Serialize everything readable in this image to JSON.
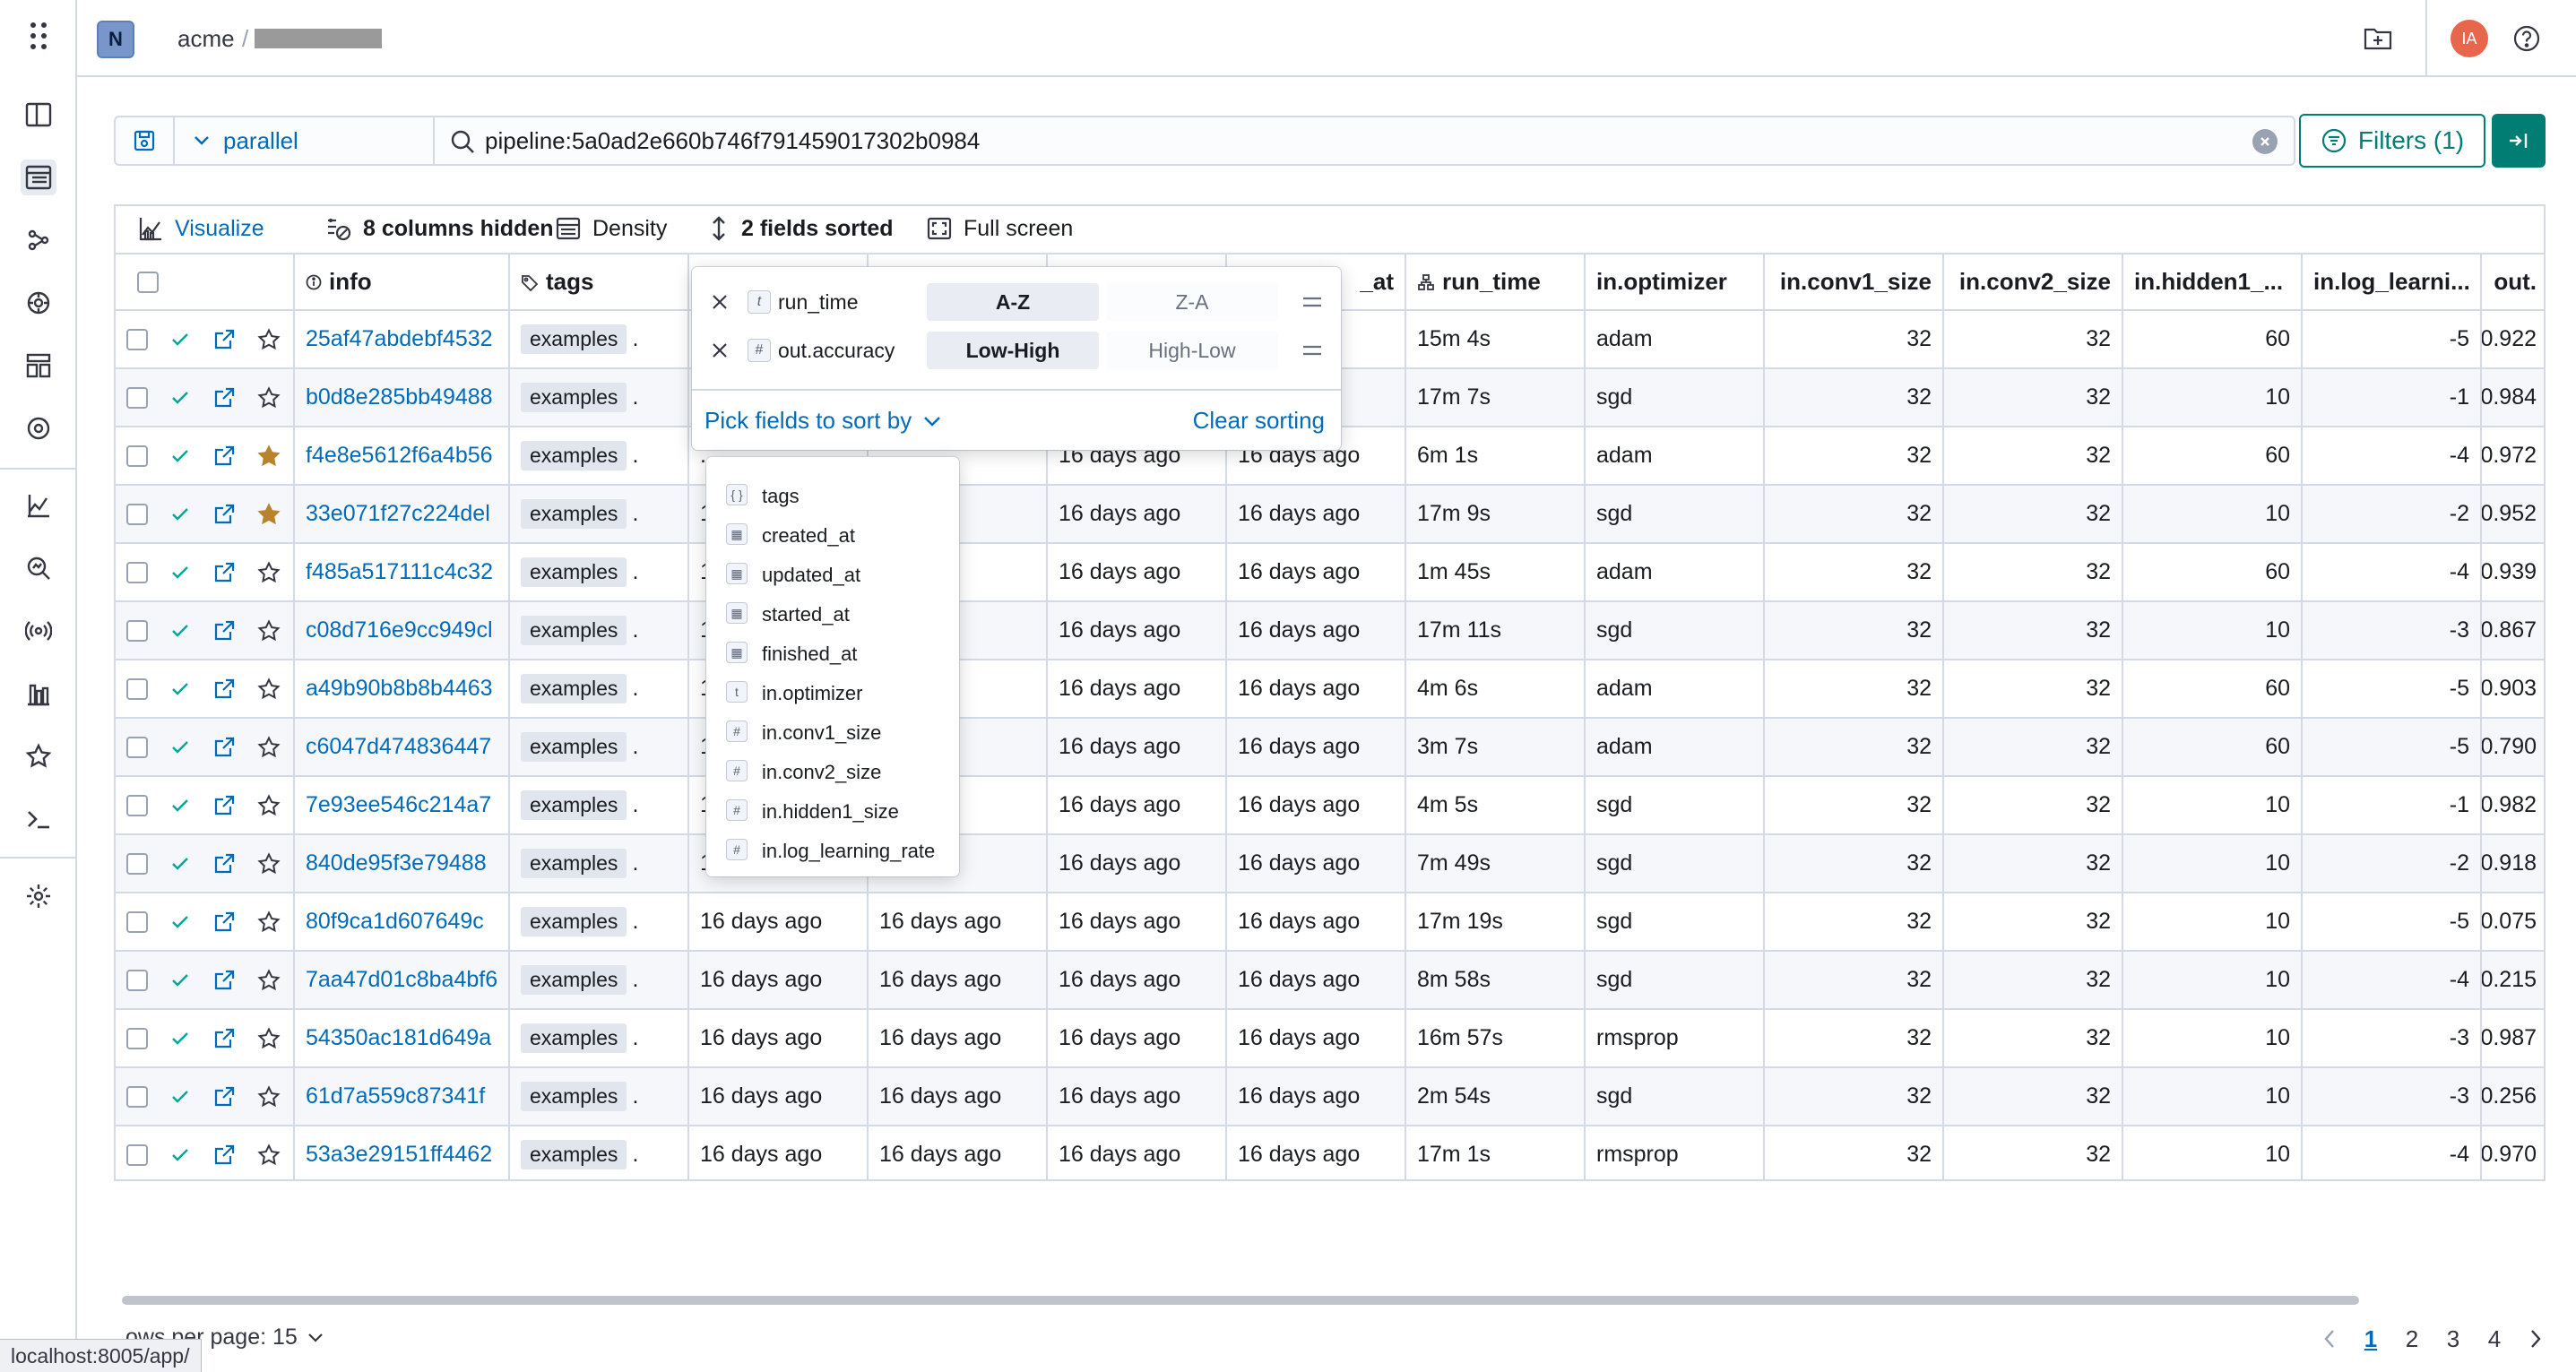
{
  "header": {
    "logo_letter": "N",
    "org": "acme",
    "separator": "/",
    "avatar_initials": "IA"
  },
  "search": {
    "view_label": "parallel",
    "query": "pipeline:5a0ad2e660b746f791459017302b0984",
    "filters_label": "Filters (1)"
  },
  "toolbar": {
    "visualize": "Visualize",
    "columns_hidden": "8 columns hidden",
    "density": "Density",
    "fields_sorted": "2 fields sorted",
    "full_screen": "Full screen"
  },
  "grid": {
    "columns": {
      "info": "info",
      "tags": "tags",
      "finished_at_partial": "_at",
      "run_time": "run_time",
      "optimizer": "in.optimizer",
      "conv1": "in.conv1_size",
      "conv2": "in.conv2_size",
      "hidden1": "in.hidden1_...",
      "lr": "in.log_learni...",
      "out": "out."
    },
    "rows": [
      {
        "id": "25af47abdebf4532",
        "tag": "examples",
        "created": ".",
        "updated": "",
        "started": "",
        "finished": "ago",
        "run_time": "15m 4s",
        "optimizer": "adam",
        "conv1": "32",
        "conv2": "32",
        "hidden1": "60",
        "lr": "-5",
        "out": "0.922",
        "starred": false
      },
      {
        "id": "b0d8e285bb49488",
        "tag": "examples",
        "created": ".",
        "updated": "",
        "started": "",
        "finished": "o",
        "run_time": "17m 7s",
        "optimizer": "sgd",
        "conv1": "32",
        "conv2": "32",
        "hidden1": "10",
        "lr": "-1",
        "out": "0.984",
        "starred": false
      },
      {
        "id": "f4e8e5612f6a4b56",
        "tag": "examples",
        "created": ".",
        "updated": "",
        "started": "16 days ago",
        "finished": "16 days ago",
        "run_time": "6m 1s",
        "optimizer": "adam",
        "conv1": "32",
        "conv2": "32",
        "hidden1": "60",
        "lr": "-4",
        "out": "0.972",
        "starred": true
      },
      {
        "id": "33e071f27c224del",
        "tag": "examples",
        "created": "1",
        "updated": "ago",
        "started": "16 days ago",
        "finished": "16 days ago",
        "run_time": "17m 9s",
        "optimizer": "sgd",
        "conv1": "32",
        "conv2": "32",
        "hidden1": "10",
        "lr": "-2",
        "out": "0.952",
        "starred": true
      },
      {
        "id": "f485a517111c4c32",
        "tag": "examples",
        "created": "1",
        "updated": "ago",
        "started": "16 days ago",
        "finished": "16 days ago",
        "run_time": "1m 45s",
        "optimizer": "adam",
        "conv1": "32",
        "conv2": "32",
        "hidden1": "60",
        "lr": "-4",
        "out": "0.939",
        "starred": false
      },
      {
        "id": "c08d716e9cc949cl",
        "tag": "examples",
        "created": "1",
        "updated": "ago",
        "started": "16 days ago",
        "finished": "16 days ago",
        "run_time": "17m 11s",
        "optimizer": "sgd",
        "conv1": "32",
        "conv2": "32",
        "hidden1": "10",
        "lr": "-3",
        "out": "0.867",
        "starred": false
      },
      {
        "id": "a49b90b8b8b4463",
        "tag": "examples",
        "created": "1",
        "updated": "ago",
        "started": "16 days ago",
        "finished": "16 days ago",
        "run_time": "4m 6s",
        "optimizer": "adam",
        "conv1": "32",
        "conv2": "32",
        "hidden1": "60",
        "lr": "-5",
        "out": "0.903",
        "starred": false
      },
      {
        "id": "c6047d474836447",
        "tag": "examples",
        "created": "1",
        "updated": "ago",
        "started": "16 days ago",
        "finished": "16 days ago",
        "run_time": "3m 7s",
        "optimizer": "adam",
        "conv1": "32",
        "conv2": "32",
        "hidden1": "60",
        "lr": "-5",
        "out": "0.790",
        "starred": false
      },
      {
        "id": "7e93ee546c214a7",
        "tag": "examples",
        "created": "1",
        "updated": "ago",
        "started": "16 days ago",
        "finished": "16 days ago",
        "run_time": "4m 5s",
        "optimizer": "sgd",
        "conv1": "32",
        "conv2": "32",
        "hidden1": "10",
        "lr": "-1",
        "out": "0.982",
        "starred": false
      },
      {
        "id": "840de95f3e79488",
        "tag": "examples",
        "created": "1",
        "updated": "ago",
        "started": "16 days ago",
        "finished": "16 days ago",
        "run_time": "7m 49s",
        "optimizer": "sgd",
        "conv1": "32",
        "conv2": "32",
        "hidden1": "10",
        "lr": "-2",
        "out": "0.918",
        "starred": false
      },
      {
        "id": "80f9ca1d607649c",
        "tag": "examples",
        "created": "16 days ago",
        "updated": "16 days ago",
        "started": "16 days ago",
        "finished": "16 days ago",
        "run_time": "17m 19s",
        "optimizer": "sgd",
        "conv1": "32",
        "conv2": "32",
        "hidden1": "10",
        "lr": "-5",
        "out": "0.075",
        "starred": false
      },
      {
        "id": "7aa47d01c8ba4bf6",
        "tag": "examples",
        "created": "16 days ago",
        "updated": "16 days ago",
        "started": "16 days ago",
        "finished": "16 days ago",
        "run_time": "8m 58s",
        "optimizer": "sgd",
        "conv1": "32",
        "conv2": "32",
        "hidden1": "10",
        "lr": "-4",
        "out": "0.215",
        "starred": false
      },
      {
        "id": "54350ac181d649a",
        "tag": "examples",
        "created": "16 days ago",
        "updated": "16 days ago",
        "started": "16 days ago",
        "finished": "16 days ago",
        "run_time": "16m 57s",
        "optimizer": "rmsprop",
        "conv1": "32",
        "conv2": "32",
        "hidden1": "10",
        "lr": "-3",
        "out": "0.987",
        "starred": false
      },
      {
        "id": "61d7a559c87341f",
        "tag": "examples",
        "created": "16 days ago",
        "updated": "16 days ago",
        "started": "16 days ago",
        "finished": "16 days ago",
        "run_time": "2m 54s",
        "optimizer": "sgd",
        "conv1": "32",
        "conv2": "32",
        "hidden1": "10",
        "lr": "-3",
        "out": "0.256",
        "starred": false
      },
      {
        "id": "53a3e29151ff4462",
        "tag": "examples",
        "created": "16 days ago",
        "updated": "16 days ago",
        "started": "16 days ago",
        "finished": "16 days ago",
        "run_time": "17m 1s",
        "optimizer": "rmsprop",
        "conv1": "32",
        "conv2": "32",
        "hidden1": "10",
        "lr": "-4",
        "out": "0.970",
        "starred": false
      }
    ]
  },
  "sort_popover": {
    "rows": [
      {
        "type_glyph": "t",
        "field": "run_time",
        "asc": "A-Z",
        "desc": "Z-A",
        "selected": "asc"
      },
      {
        "type_glyph": "#",
        "field": "out.accuracy",
        "asc": "Low-High",
        "desc": "High-Low",
        "selected": "asc"
      }
    ],
    "pick_fields": "Pick fields to sort by",
    "clear_sorting": "Clear sorting"
  },
  "field_list": [
    {
      "glyph": "{ }",
      "name": "tags"
    },
    {
      "glyph": "▦",
      "name": "created_at"
    },
    {
      "glyph": "▦",
      "name": "updated_at"
    },
    {
      "glyph": "▦",
      "name": "started_at"
    },
    {
      "glyph": "▦",
      "name": "finished_at"
    },
    {
      "glyph": "t",
      "name": "in.optimizer"
    },
    {
      "glyph": "#",
      "name": "in.conv1_size"
    },
    {
      "glyph": "#",
      "name": "in.conv2_size"
    },
    {
      "glyph": "#",
      "name": "in.hidden1_size"
    },
    {
      "glyph": "#",
      "name": "in.log_learning_rate"
    }
  ],
  "footer": {
    "rows_per_page": "ows per page: 15",
    "pages": [
      "1",
      "2",
      "3",
      "4"
    ],
    "current_page": "1",
    "url_tooltip": "localhost:8005/app/"
  },
  "colors": {
    "primary": "#006bb8",
    "accent": "#017d73",
    "success": "#00a69b",
    "star": "#b9822c",
    "avatar": "#e7664c"
  }
}
